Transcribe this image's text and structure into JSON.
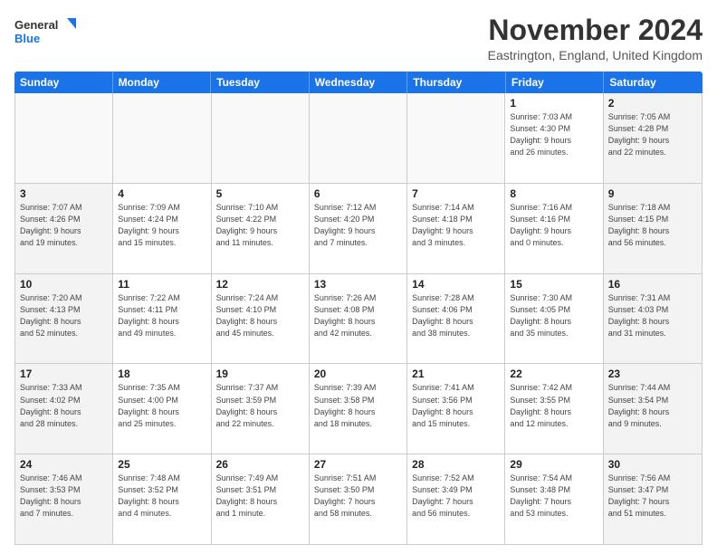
{
  "logo": {
    "line1": "General",
    "line2": "Blue"
  },
  "title": "November 2024",
  "location": "Eastrington, England, United Kingdom",
  "weekdays": [
    "Sunday",
    "Monday",
    "Tuesday",
    "Wednesday",
    "Thursday",
    "Friday",
    "Saturday"
  ],
  "weeks": [
    [
      {
        "day": "",
        "info": ""
      },
      {
        "day": "",
        "info": ""
      },
      {
        "day": "",
        "info": ""
      },
      {
        "day": "",
        "info": ""
      },
      {
        "day": "",
        "info": ""
      },
      {
        "day": "1",
        "info": "Sunrise: 7:03 AM\nSunset: 4:30 PM\nDaylight: 9 hours\nand 26 minutes."
      },
      {
        "day": "2",
        "info": "Sunrise: 7:05 AM\nSunset: 4:28 PM\nDaylight: 9 hours\nand 22 minutes."
      }
    ],
    [
      {
        "day": "3",
        "info": "Sunrise: 7:07 AM\nSunset: 4:26 PM\nDaylight: 9 hours\nand 19 minutes."
      },
      {
        "day": "4",
        "info": "Sunrise: 7:09 AM\nSunset: 4:24 PM\nDaylight: 9 hours\nand 15 minutes."
      },
      {
        "day": "5",
        "info": "Sunrise: 7:10 AM\nSunset: 4:22 PM\nDaylight: 9 hours\nand 11 minutes."
      },
      {
        "day": "6",
        "info": "Sunrise: 7:12 AM\nSunset: 4:20 PM\nDaylight: 9 hours\nand 7 minutes."
      },
      {
        "day": "7",
        "info": "Sunrise: 7:14 AM\nSunset: 4:18 PM\nDaylight: 9 hours\nand 3 minutes."
      },
      {
        "day": "8",
        "info": "Sunrise: 7:16 AM\nSunset: 4:16 PM\nDaylight: 9 hours\nand 0 minutes."
      },
      {
        "day": "9",
        "info": "Sunrise: 7:18 AM\nSunset: 4:15 PM\nDaylight: 8 hours\nand 56 minutes."
      }
    ],
    [
      {
        "day": "10",
        "info": "Sunrise: 7:20 AM\nSunset: 4:13 PM\nDaylight: 8 hours\nand 52 minutes."
      },
      {
        "day": "11",
        "info": "Sunrise: 7:22 AM\nSunset: 4:11 PM\nDaylight: 8 hours\nand 49 minutes."
      },
      {
        "day": "12",
        "info": "Sunrise: 7:24 AM\nSunset: 4:10 PM\nDaylight: 8 hours\nand 45 minutes."
      },
      {
        "day": "13",
        "info": "Sunrise: 7:26 AM\nSunset: 4:08 PM\nDaylight: 8 hours\nand 42 minutes."
      },
      {
        "day": "14",
        "info": "Sunrise: 7:28 AM\nSunset: 4:06 PM\nDaylight: 8 hours\nand 38 minutes."
      },
      {
        "day": "15",
        "info": "Sunrise: 7:30 AM\nSunset: 4:05 PM\nDaylight: 8 hours\nand 35 minutes."
      },
      {
        "day": "16",
        "info": "Sunrise: 7:31 AM\nSunset: 4:03 PM\nDaylight: 8 hours\nand 31 minutes."
      }
    ],
    [
      {
        "day": "17",
        "info": "Sunrise: 7:33 AM\nSunset: 4:02 PM\nDaylight: 8 hours\nand 28 minutes."
      },
      {
        "day": "18",
        "info": "Sunrise: 7:35 AM\nSunset: 4:00 PM\nDaylight: 8 hours\nand 25 minutes."
      },
      {
        "day": "19",
        "info": "Sunrise: 7:37 AM\nSunset: 3:59 PM\nDaylight: 8 hours\nand 22 minutes."
      },
      {
        "day": "20",
        "info": "Sunrise: 7:39 AM\nSunset: 3:58 PM\nDaylight: 8 hours\nand 18 minutes."
      },
      {
        "day": "21",
        "info": "Sunrise: 7:41 AM\nSunset: 3:56 PM\nDaylight: 8 hours\nand 15 minutes."
      },
      {
        "day": "22",
        "info": "Sunrise: 7:42 AM\nSunset: 3:55 PM\nDaylight: 8 hours\nand 12 minutes."
      },
      {
        "day": "23",
        "info": "Sunrise: 7:44 AM\nSunset: 3:54 PM\nDaylight: 8 hours\nand 9 minutes."
      }
    ],
    [
      {
        "day": "24",
        "info": "Sunrise: 7:46 AM\nSunset: 3:53 PM\nDaylight: 8 hours\nand 7 minutes."
      },
      {
        "day": "25",
        "info": "Sunrise: 7:48 AM\nSunset: 3:52 PM\nDaylight: 8 hours\nand 4 minutes."
      },
      {
        "day": "26",
        "info": "Sunrise: 7:49 AM\nSunset: 3:51 PM\nDaylight: 8 hours\nand 1 minute."
      },
      {
        "day": "27",
        "info": "Sunrise: 7:51 AM\nSunset: 3:50 PM\nDaylight: 7 hours\nand 58 minutes."
      },
      {
        "day": "28",
        "info": "Sunrise: 7:52 AM\nSunset: 3:49 PM\nDaylight: 7 hours\nand 56 minutes."
      },
      {
        "day": "29",
        "info": "Sunrise: 7:54 AM\nSunset: 3:48 PM\nDaylight: 7 hours\nand 53 minutes."
      },
      {
        "day": "30",
        "info": "Sunrise: 7:56 AM\nSunset: 3:47 PM\nDaylight: 7 hours\nand 51 minutes."
      }
    ]
  ]
}
